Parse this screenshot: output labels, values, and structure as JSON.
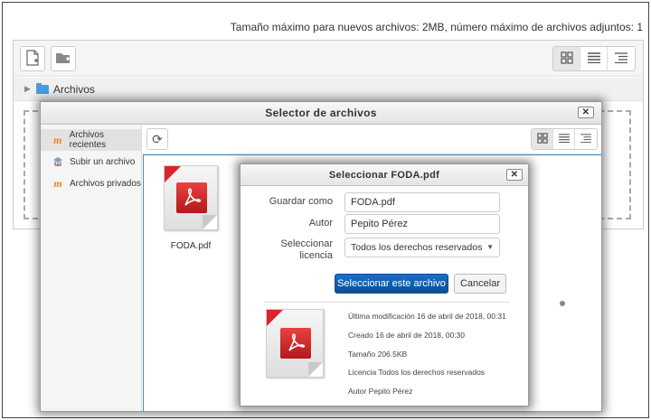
{
  "limit_text": "Tamaño máximo para nuevos archivos: 2MB, número máximo de archivos adjuntos: 1",
  "filemanager": {
    "toolbar": {
      "add_icon": "add-file-icon",
      "create_folder_icon": "create-folder-icon",
      "views": [
        "icons-view-icon",
        "list-view-icon",
        "tree-view-icon"
      ]
    },
    "path_label": "Archivos"
  },
  "filepicker": {
    "title": "Selector de archivos",
    "close_label": "✕",
    "repositories": [
      {
        "label": "Archivos recientes",
        "icon": "moodle-icon"
      },
      {
        "label": "Subir un archivo",
        "icon": "upload-icon"
      },
      {
        "label": "Archivos privados",
        "icon": "moodle-icon"
      }
    ],
    "refresh_glyph": "⟳",
    "file": {
      "name": "FODA.pdf",
      "icon": "pdf-file-icon"
    }
  },
  "select_dialog": {
    "title": "Seleccionar FODA.pdf",
    "close_label": "✕",
    "fields": {
      "saveas_label": "Guardar como",
      "saveas_value": "FODA.pdf",
      "author_label": "Autor",
      "author_value": "Pepito Pérez",
      "license_label_1": "Seleccionar",
      "license_label_2": "licencia",
      "license_value": "Todos los derechos reservados"
    },
    "select_button": "Seleccionar este archivo",
    "cancel_button": "Cancelar",
    "info": {
      "modified": "Última modificación  16 de abril de 2018, 00:31",
      "created": "Creado  16 de abril de 2018, 00:30",
      "size": "Tamaño  206.5KB",
      "license": "Licencia  Todos los derechos reservados",
      "author": "Autor  Pepito Pérez"
    }
  },
  "colors": {
    "primary_button": "#0a4f96",
    "folder": "#4a9be0",
    "pdf_red": "#d9262a",
    "moodle_orange": "#f58220"
  }
}
